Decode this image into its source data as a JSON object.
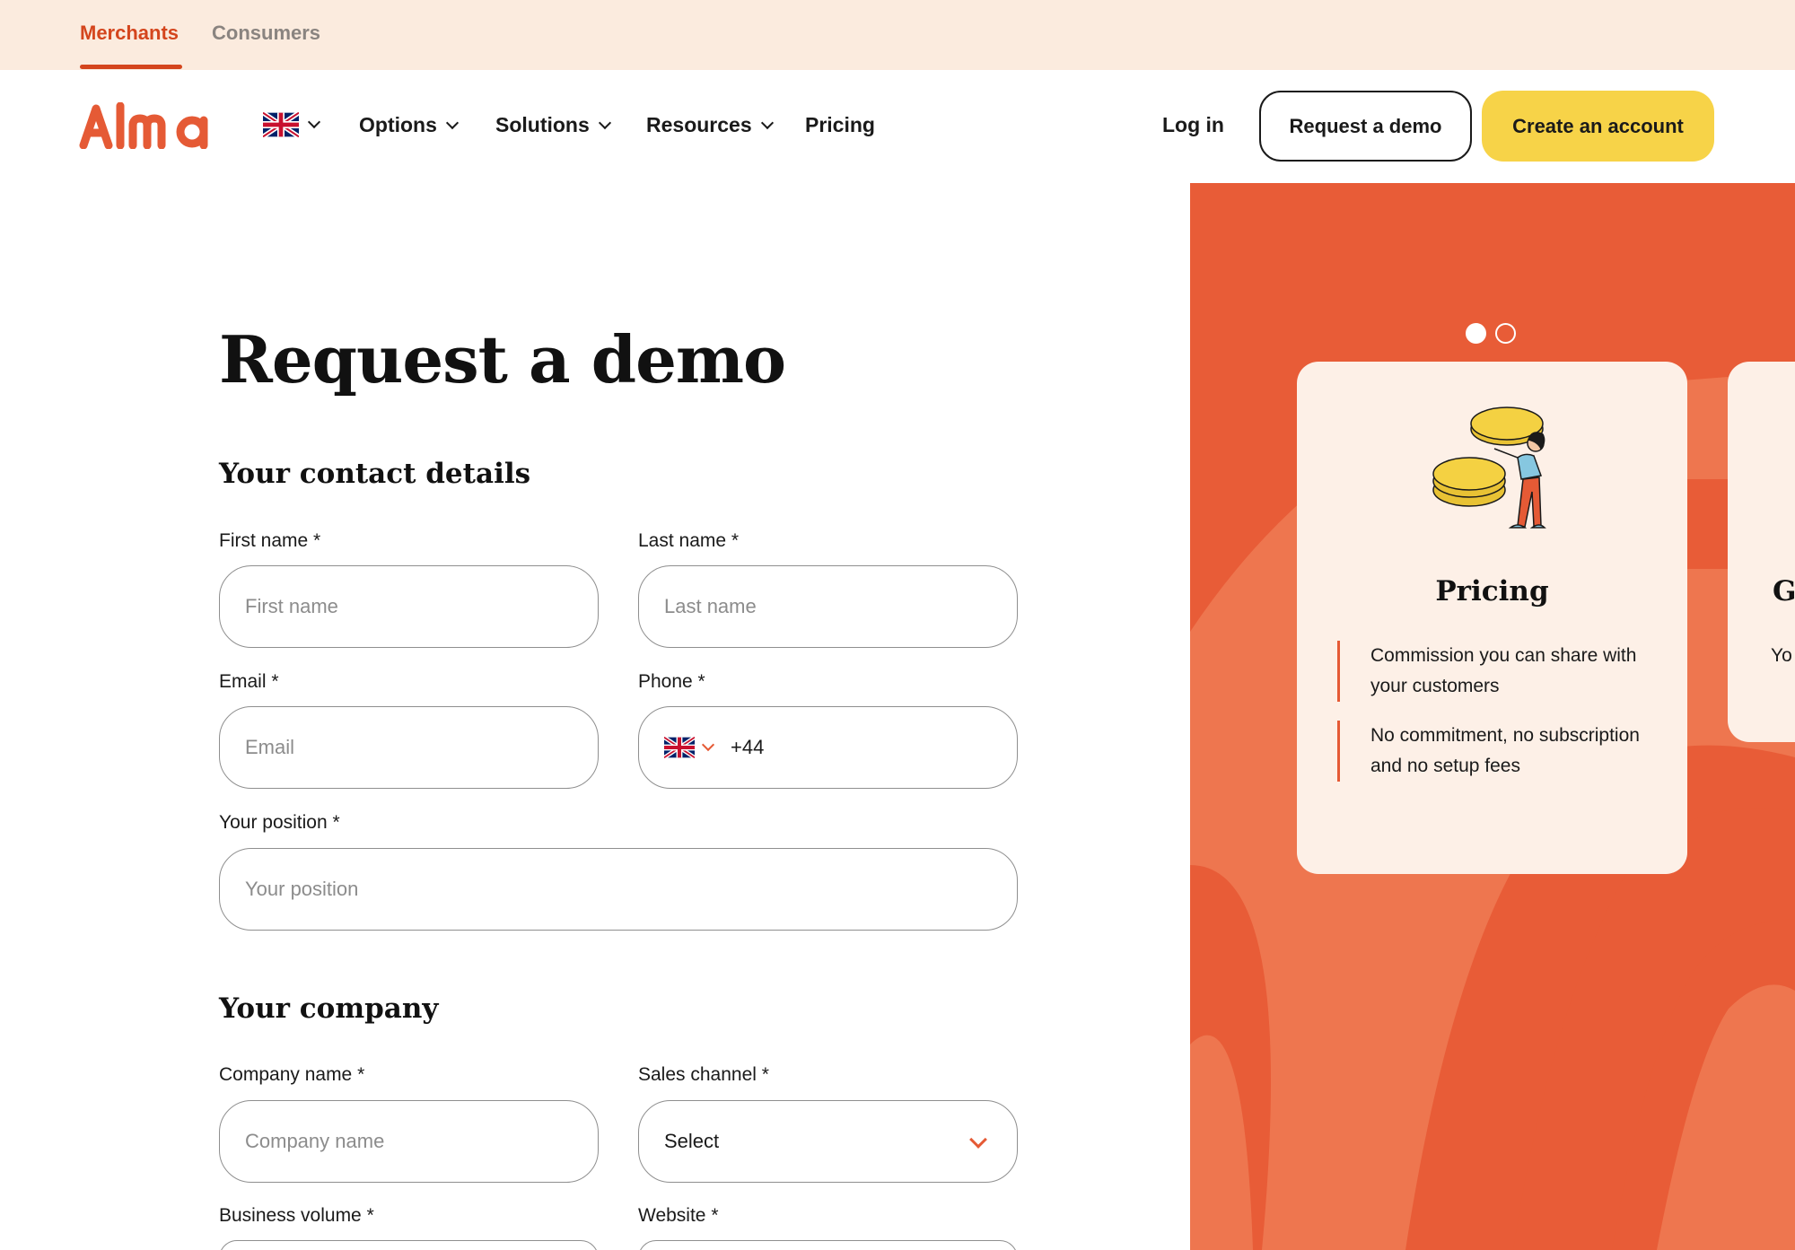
{
  "topbar": {
    "tabs": [
      {
        "label": "Merchants",
        "active": true
      },
      {
        "label": "Consumers",
        "active": false
      }
    ]
  },
  "nav": {
    "logo_text": "Alma",
    "language_flag": "uk-flag-icon",
    "items": [
      {
        "label": "Options",
        "has_dropdown": true
      },
      {
        "label": "Solutions",
        "has_dropdown": true
      },
      {
        "label": "Resources",
        "has_dropdown": true
      },
      {
        "label": "Pricing",
        "has_dropdown": false
      }
    ],
    "login_label": "Log in",
    "demo_label": "Request a demo",
    "create_label": "Create an account"
  },
  "form": {
    "title": "Request a demo",
    "contact_section": "Your contact details",
    "first_name": {
      "label": "First name *",
      "placeholder": "First name"
    },
    "last_name": {
      "label": "Last name *",
      "placeholder": "Last name"
    },
    "email": {
      "label": "Email *",
      "placeholder": "Email"
    },
    "phone": {
      "label": "Phone *",
      "prefix": "+44",
      "flag": "uk-flag-icon"
    },
    "position": {
      "label": "Your position *",
      "placeholder": "Your position"
    },
    "company_section": "Your company",
    "company_name": {
      "label": "Company name *",
      "placeholder": "Company name"
    },
    "sales_channel": {
      "label": "Sales channel *",
      "value": "Select"
    },
    "business_volume": {
      "label": "Business volume *"
    },
    "website": {
      "label": "Website *"
    }
  },
  "carousel": {
    "active_index": 0,
    "count": 2,
    "cards": [
      {
        "title": "Pricing",
        "illustration": "coins-person-illustration",
        "bullets": [
          "Commission you can share with your customers",
          "No commitment, no subscription and no setup fees"
        ]
      },
      {
        "title_visible": "G",
        "text_visible": "Yo"
      }
    ]
  },
  "colors": {
    "brand_orange": "#e85c37",
    "accent_red": "#d4451d",
    "cta_yellow": "#f7d348",
    "topbar_bg": "#fbebde",
    "card_bg": "#fdf0e7"
  }
}
